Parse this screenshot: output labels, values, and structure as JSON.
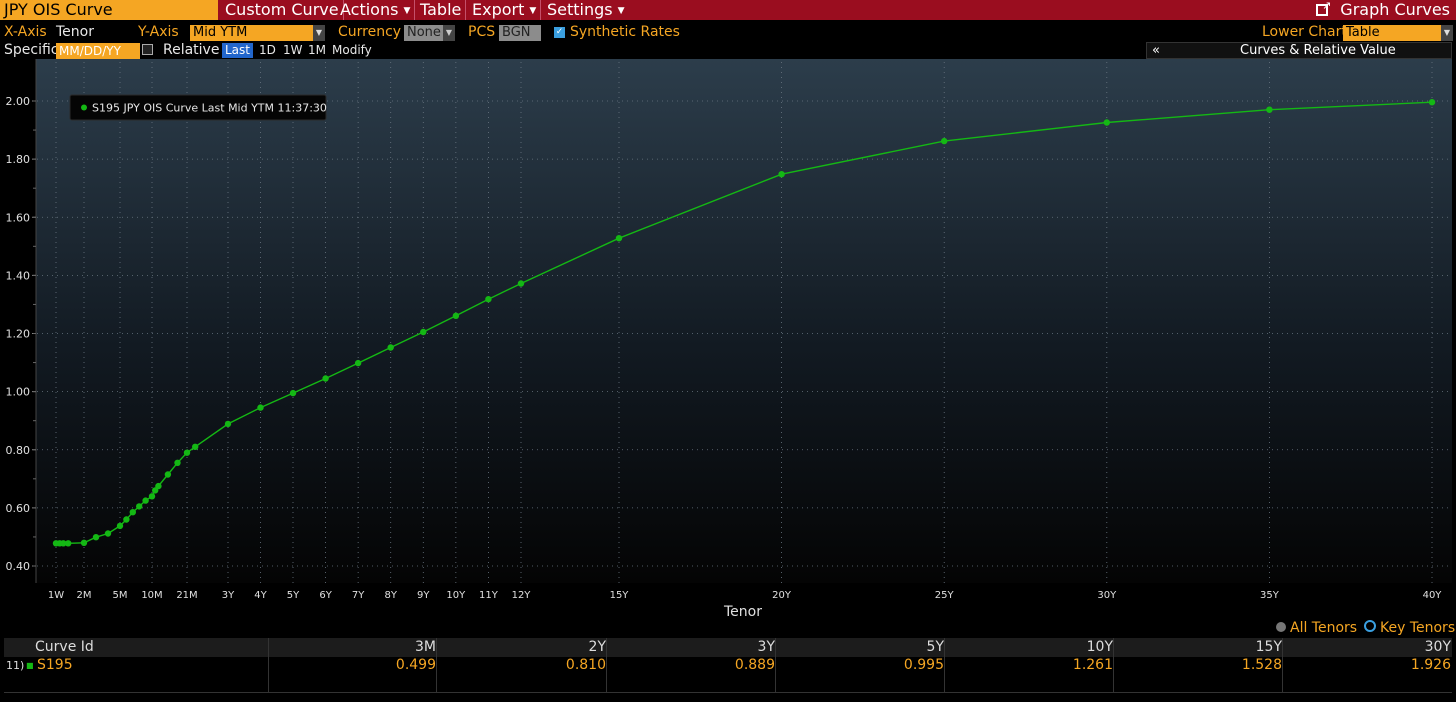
{
  "topbar": {
    "title": "JPY OIS Curve",
    "menus": [
      "Custom Curve",
      "Actions",
      "Table",
      "Export",
      "Settings"
    ],
    "graph_curves": "Graph Curves"
  },
  "controls": {
    "xaxis_label": "X-Axis",
    "xaxis_value": "Tenor",
    "yaxis_label": "Y-Axis",
    "yaxis_value": "Mid YTM",
    "currency_label": "Currency",
    "currency_value": "None",
    "pcs_label": "PCS",
    "pcs_value": "BGN",
    "synthetic_label": "Synthetic Rates",
    "lower_chart_label": "Lower Chart",
    "lower_chart_value": "Table",
    "specific_label": "Specific",
    "date_placeholder": "MM/DD/YY",
    "relative_label": "Relative",
    "range_buttons": [
      "Last",
      "1D",
      "1W",
      "1M"
    ],
    "modify_label": "Modify",
    "collapse_symbol": "«",
    "curves_rv_label": "Curves & Relative Value"
  },
  "chart_data": {
    "type": "line",
    "series": [
      {
        "name": "S195 JPY OIS Curve Last Mid YTM 11:37:30",
        "color": "#14b814",
        "x": [
          "1W",
          "2W",
          "3W",
          "1M",
          "2M",
          "3M",
          "4M",
          "5M",
          "6M",
          "7M",
          "8M",
          "9M",
          "10M",
          "11M",
          "1Y",
          "15M",
          "18M",
          "21M",
          "2Y",
          "3Y",
          "4Y",
          "5Y",
          "6Y",
          "7Y",
          "8Y",
          "9Y",
          "10Y",
          "11Y",
          "12Y",
          "15Y",
          "20Y",
          "25Y",
          "30Y",
          "35Y",
          "40Y"
        ],
        "x_years": [
          0.0192,
          0.0385,
          0.0577,
          0.0833,
          0.1667,
          0.25,
          0.3333,
          0.4167,
          0.5,
          0.5833,
          0.6667,
          0.75,
          0.8333,
          0.9167,
          1,
          1.25,
          1.5,
          1.75,
          2,
          3,
          4,
          5,
          6,
          7,
          8,
          9,
          10,
          11,
          12,
          15,
          20,
          25,
          30,
          35,
          40
        ],
        "y": [
          0.478,
          0.478,
          0.478,
          0.478,
          0.48,
          0.499,
          0.512,
          0.538,
          0.56,
          0.585,
          0.605,
          0.625,
          0.64,
          0.66,
          0.675,
          0.715,
          0.755,
          0.79,
          0.81,
          0.889,
          0.945,
          0.995,
          1.045,
          1.098,
          1.152,
          1.205,
          1.261,
          1.318,
          1.372,
          1.528,
          1.748,
          1.862,
          1.926,
          1.97,
          1.996
        ]
      }
    ],
    "xlabel": "Tenor",
    "x_ticks": [
      "1W",
      "2M",
      "5M",
      "10M",
      "21M",
      "3Y",
      "4Y",
      "5Y",
      "6Y",
      "7Y",
      "8Y",
      "9Y",
      "10Y",
      "11Y",
      "12Y",
      "15Y",
      "20Y",
      "25Y",
      "30Y",
      "35Y",
      "40Y"
    ],
    "x_tick_years": [
      0.0192,
      0.1667,
      0.4167,
      0.8333,
      1.75,
      3,
      4,
      5,
      6,
      7,
      8,
      9,
      10,
      11,
      12,
      15,
      20,
      25,
      30,
      35,
      40
    ],
    "y_ticks": [
      "0.40",
      "0.60",
      "0.80",
      "1.00",
      "1.20",
      "1.40",
      "1.60",
      "1.80",
      "2.00"
    ],
    "ylim": [
      0.4,
      2.0
    ],
    "grid": true,
    "legend_position": "top-left"
  },
  "table": {
    "headers": [
      "Curve Id",
      "3M",
      "2Y",
      "3Y",
      "5Y",
      "10Y",
      "15Y",
      "30Y"
    ],
    "row_index": "11)",
    "row_id": "S195",
    "row_values": [
      "0.499",
      "0.810",
      "0.889",
      "0.995",
      "1.261",
      "1.528",
      "1.926"
    ],
    "all_tenors_label": "All Tenors",
    "key_tenors_label": "Key Tenors"
  },
  "colors": {
    "accent": "#f5a623",
    "topbar": "#9a0d1f",
    "series": "#14b814"
  }
}
